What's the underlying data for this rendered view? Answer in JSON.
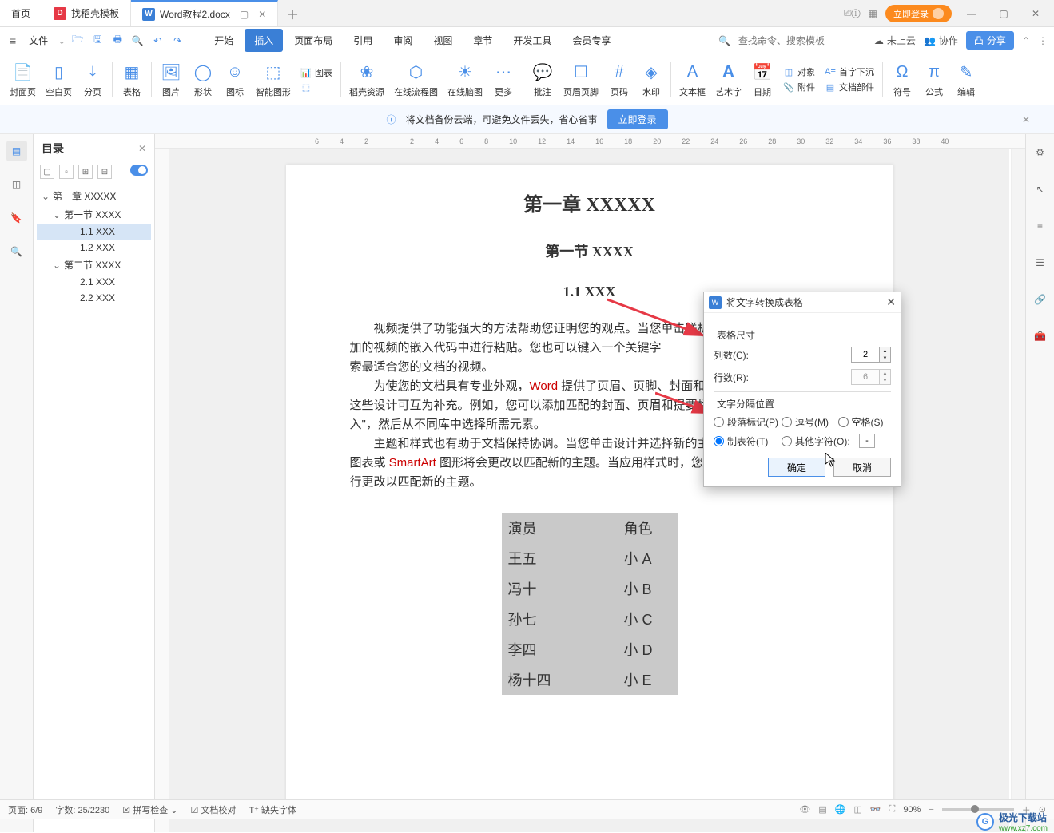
{
  "titlebar": {
    "tabs": {
      "home": "首页",
      "template": "找稻壳模板",
      "doc": "Word教程2.docx"
    },
    "login_btn": "立即登录"
  },
  "menubar": {
    "file": "文件",
    "tabs": [
      "开始",
      "插入",
      "页面布局",
      "引用",
      "审阅",
      "视图",
      "章节",
      "开发工具",
      "会员专享"
    ],
    "active_index": 1,
    "search_placeholder": "查找命令、搜索模板",
    "cloud": "未上云",
    "coop": "协作",
    "share": "分享"
  },
  "ribbon": {
    "cover": "封面页",
    "blank": "空白页",
    "break": "分页",
    "table": "表格",
    "image": "图片",
    "shape": "形状",
    "icon": "图标",
    "smartart": "智能图形",
    "chart_label": "图表",
    "ole_label": "",
    "daoke": "稻壳资源",
    "flow": "在线流程图",
    "mind": "在线脑图",
    "more": "更多",
    "comment": "批注",
    "headerfooter": "页眉页脚",
    "pagenum": "页码",
    "watermark": "水印",
    "textbox": "文本框",
    "wordart": "艺术字",
    "date": "日期",
    "attachment": "附件",
    "object": "对象",
    "dropcap": "首字下沉",
    "docpart": "文档部件",
    "symbol": "符号",
    "formula": "公式",
    "edit": "编辑"
  },
  "backup": {
    "text": "将文档备份云端，可避免文件丢失，省心省事",
    "btn": "立即登录"
  },
  "outline": {
    "title": "目录",
    "items": [
      {
        "level": 1,
        "text": "第一章  XXXXX",
        "chevron": "v"
      },
      {
        "level": 2,
        "text": "第一节  XXXX",
        "chevron": "v"
      },
      {
        "level": 3,
        "text": "1.1 XXX",
        "selected": true
      },
      {
        "level": 3,
        "text": "1.2 XXX"
      },
      {
        "level": 2,
        "text": "第二节  XXXX",
        "chevron": "v"
      },
      {
        "level": 3,
        "text": "2.1 XXX"
      },
      {
        "level": 3,
        "text": "2.2 XXX"
      }
    ]
  },
  "ruler_marks": [
    "6",
    "4",
    "2",
    "",
    "2",
    "4",
    "6",
    "8",
    "10",
    "12",
    "14",
    "16",
    "18",
    "20",
    "22",
    "24",
    "26",
    "28",
    "30",
    "32",
    "34",
    "36",
    "38",
    "40"
  ],
  "document": {
    "h1": "第一章  XXXXX",
    "h2": "第一节  XXXX",
    "h3": "1.1 XXX",
    "p1_a": "视频提供了功能强大的方法帮助您证明您的观点。当您单击联机视频时，可以在想要添加的视频的嵌入代码中进行粘贴。您也可以键入一个关键字",
    "p1_b": "索最适合您的文档的视频。",
    "p2_a": "为使您的文档具有专业外观，",
    "p2_word": "Word",
    "p2_b": " 提供了页眉、页脚、封面和文",
    "p2_c": "这些设计可互为补充。例如，您可以添加匹配的封面、页眉和提要栏",
    "p2_d": "入\"，然后从不同库中选择所需元素。",
    "p3_a": "主题和样式也有助于文档保持协调。当您单击设计并选择新的主题",
    "p3_b": "图表或 ",
    "p3_smartart": "SmartArt",
    "p3_c": " 图形将会更改以匹配新的主题。当应用样式时，您的",
    "p3_d": "行更改以匹配新的主题。",
    "table": [
      [
        "演员",
        "角色"
      ],
      [
        "王五",
        "小 A"
      ],
      [
        "冯十",
        "小 B"
      ],
      [
        "孙七",
        "小 C"
      ],
      [
        "李四",
        "小 D"
      ],
      [
        "杨十四",
        "小 E"
      ]
    ]
  },
  "dialog": {
    "title": "将文字转换成表格",
    "size_group": "表格尺寸",
    "cols_label": "列数(C):",
    "cols_value": "2",
    "rows_label": "行数(R):",
    "rows_value": "6",
    "sep_group": "文字分隔位置",
    "radio_para": "段落标记(P)",
    "radio_comma": "逗号(M)",
    "radio_space": "空格(S)",
    "radio_tab": "制表符(T)",
    "radio_other": "其他字符(O):",
    "other_value": "-",
    "ok": "确定",
    "cancel": "取消"
  },
  "statusbar": {
    "page": "页面: 6/9",
    "words": "字数: 25/2230",
    "spell": "拼写检查",
    "proof": "文档校对",
    "font": "缺失字体",
    "zoom": "90%"
  },
  "watermark": {
    "name": "极光下载站",
    "url": "www.xz7.com"
  }
}
